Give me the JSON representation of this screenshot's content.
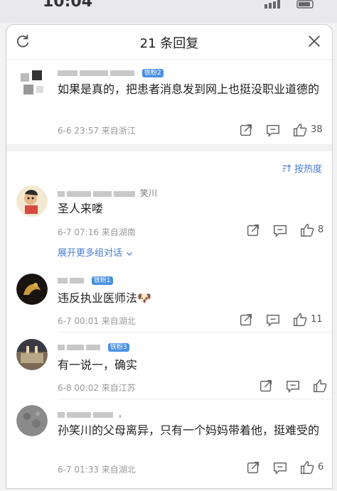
{
  "status_time": "10:04",
  "header": {
    "title": "21 条回复"
  },
  "sort_label": "按热度",
  "expand_label": "展开更多组对话",
  "main_comment": {
    "name_suffix": "",
    "badge": "铁粉2",
    "text": "如果是真的，把患者消息发到网上也挺没职业道德的",
    "meta": "6-6 23:57  来自浙江",
    "likes": "38"
  },
  "replies": [
    {
      "name_suffix": "笑川",
      "badge": "",
      "text": "圣人来喽",
      "meta": "6-7 07:16  来自湖南",
      "likes": "8"
    },
    {
      "name_suffix": "",
      "badge": "铁粉1",
      "text": "违反执业医师法",
      "emoji": "🐶",
      "meta": "6-7 00:01  来自湖北",
      "likes": "11"
    },
    {
      "name_suffix": "",
      "badge": "铁粉3",
      "text": "有一说一，确实",
      "meta": "6-8 00:02  来自江苏",
      "likes": ""
    },
    {
      "name_suffix": "，",
      "badge": "",
      "text": "孙笑川的父母离异，只有一个妈妈带着他，挺难受的",
      "meta": "6-7 01:33  来自湖北",
      "likes": "6"
    }
  ]
}
